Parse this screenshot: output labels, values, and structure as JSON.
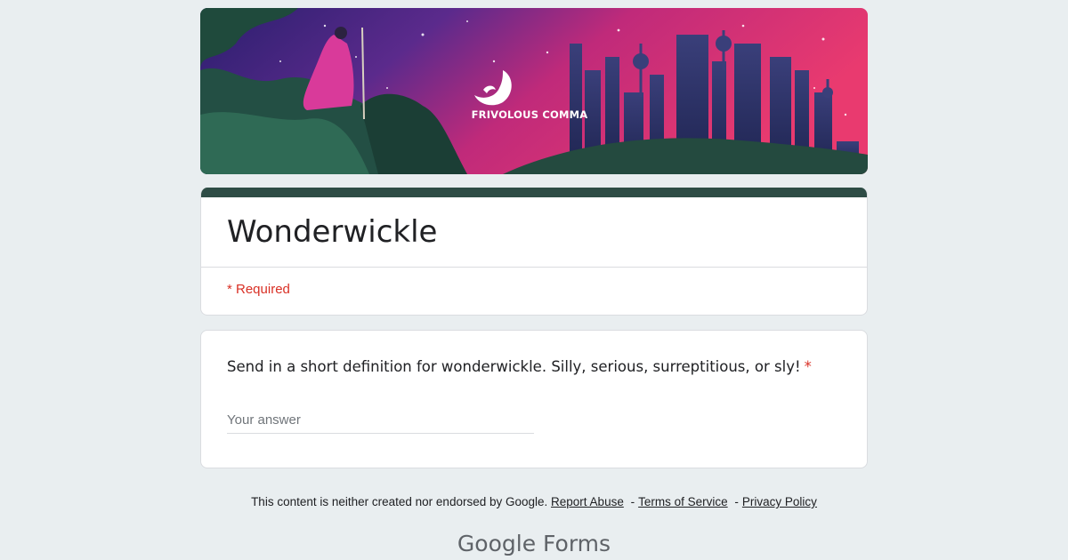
{
  "banner": {
    "brand_text": "FRIVOLOUS COMMA"
  },
  "form": {
    "title": "Wonderwickle",
    "required_note": "* Required"
  },
  "question": {
    "text": "Send in a short definition for wonderwickle. Silly, serious, surreptitious, or sly!",
    "required_marker": "*",
    "placeholder": "Your answer"
  },
  "footer": {
    "disclaimer": "This content is neither created nor endorsed by Google.",
    "report_abuse": "Report Abuse",
    "separator": "-",
    "terms": "Terms of Service",
    "privacy": "Privacy Policy",
    "google": "Google",
    "forms": "Forms"
  },
  "colors": {
    "accent": "#2e4c45",
    "required": "#d93025",
    "background": "#e9eef0"
  }
}
